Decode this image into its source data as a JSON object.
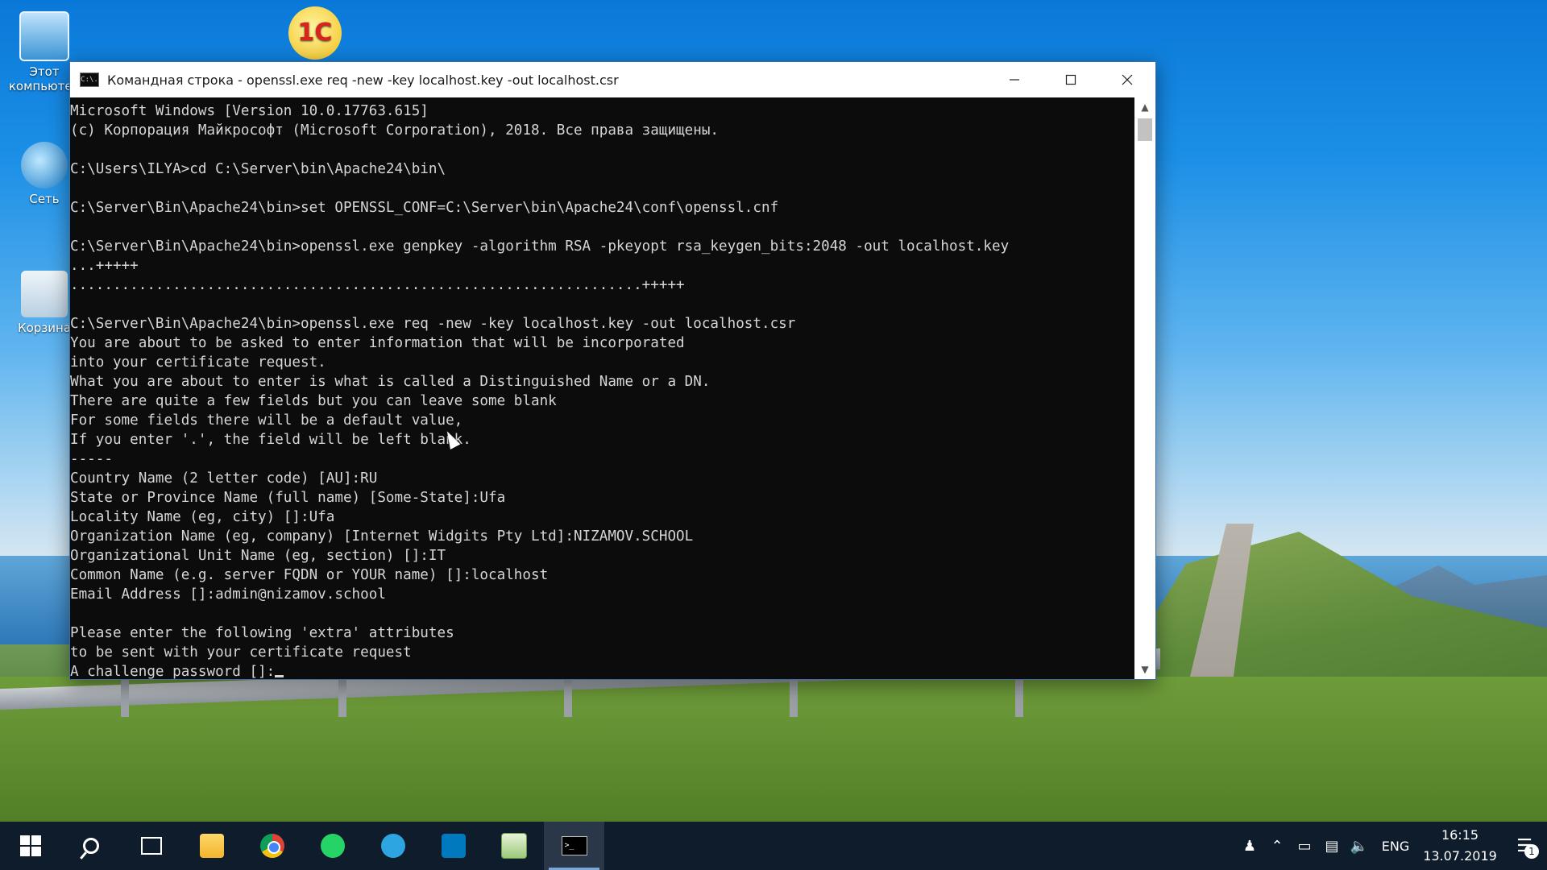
{
  "desktop": {
    "icons": [
      {
        "label": "Этот компьютер"
      },
      {
        "label": "Сеть"
      },
      {
        "label": "Корзина"
      },
      {
        "label": "1С"
      }
    ]
  },
  "window": {
    "title": "Командная строка - openssl.exe  req -new -key localhost.key -out localhost.csr",
    "icon_text": "C:\\."
  },
  "console": {
    "lines": [
      "Microsoft Windows [Version 10.0.17763.615]",
      "(c) Корпорация Майкрософт (Microsoft Corporation), 2018. Все права защищены.",
      "",
      "C:\\Users\\ILYA>cd C:\\Server\\bin\\Apache24\\bin\\",
      "",
      "C:\\Server\\Bin\\Apache24\\bin>set OPENSSL_CONF=C:\\Server\\bin\\Apache24\\conf\\openssl.cnf",
      "",
      "C:\\Server\\Bin\\Apache24\\bin>openssl.exe genpkey -algorithm RSA -pkeyopt rsa_keygen_bits:2048 -out localhost.key",
      "...+++++",
      "...................................................................+++++",
      "",
      "C:\\Server\\Bin\\Apache24\\bin>openssl.exe req -new -key localhost.key -out localhost.csr",
      "You are about to be asked to enter information that will be incorporated",
      "into your certificate request.",
      "What you are about to enter is what is called a Distinguished Name or a DN.",
      "There are quite a few fields but you can leave some blank",
      "For some fields there will be a default value,",
      "If you enter '.', the field will be left blank.",
      "-----",
      "Country Name (2 letter code) [AU]:RU",
      "State or Province Name (full name) [Some-State]:Ufa",
      "Locality Name (eg, city) []:Ufa",
      "Organization Name (eg, company) [Internet Widgits Pty Ltd]:NIZAMOV.SCHOOL",
      "Organizational Unit Name (eg, section) []:IT",
      "Common Name (e.g. server FQDN or YOUR name) []:localhost",
      "Email Address []:admin@nizamov.school",
      "",
      "Please enter the following 'extra' attributes",
      "to be sent with your certificate request",
      "A challenge password []:"
    ]
  },
  "taskbar": {
    "language": "ENG",
    "time": "16:15",
    "date": "13.07.2019",
    "notification_count": "1"
  }
}
